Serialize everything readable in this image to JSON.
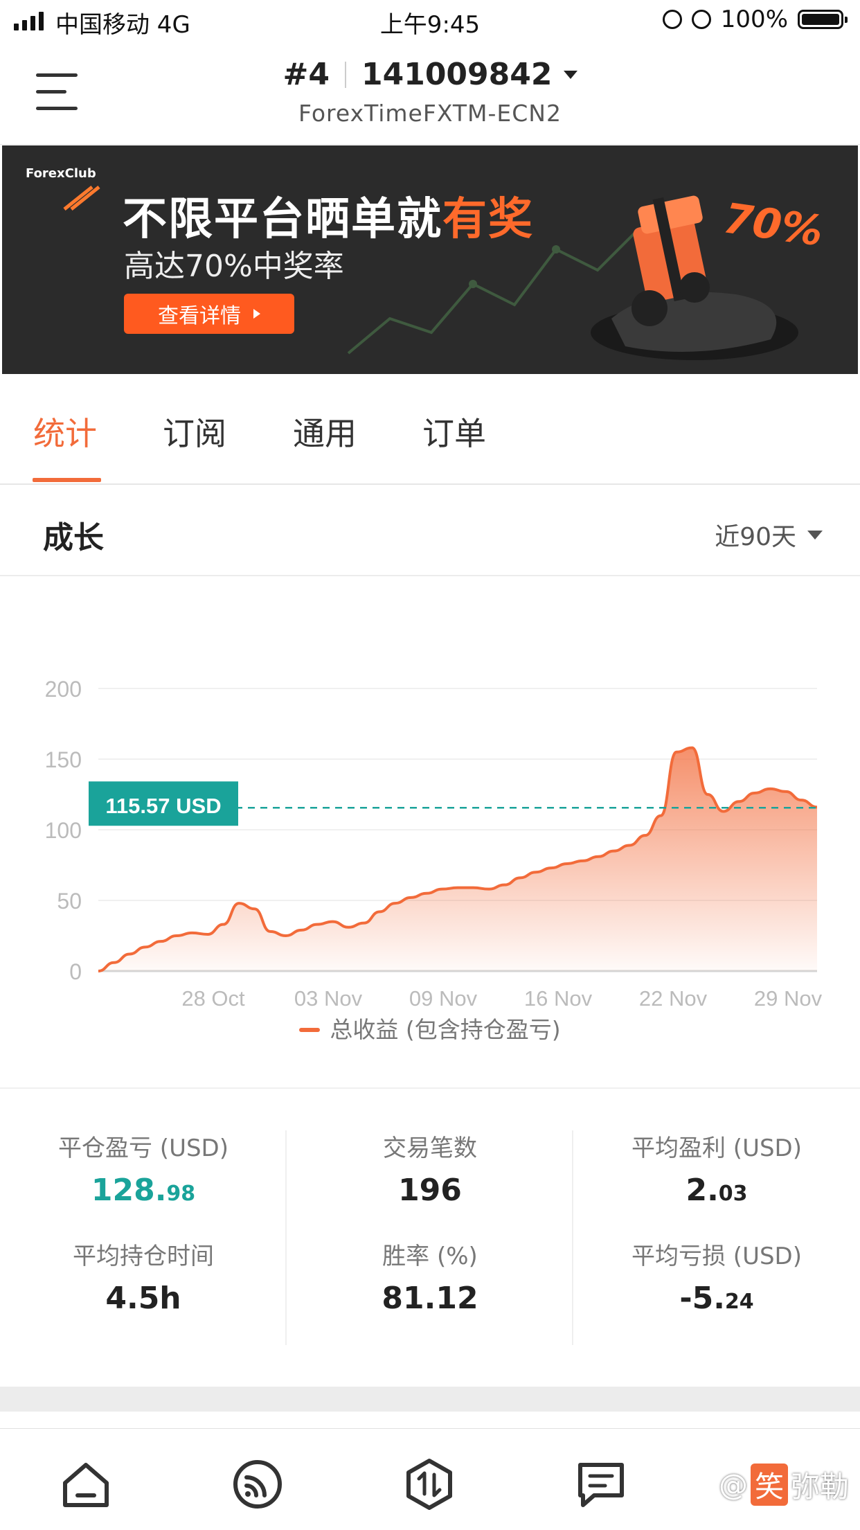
{
  "status_bar": {
    "carrier": "中国移动 4G",
    "time": "上午9:45",
    "battery": "100%",
    "icons": [
      "signal-icon",
      "alarm-icon",
      "rotation-lock-icon",
      "battery-icon"
    ]
  },
  "header": {
    "account_index": "#4",
    "account_number": "141009842",
    "server": "ForexTimeFXTM-ECN2",
    "menu_icon": "hamburger-menu-icon"
  },
  "banner": {
    "brand": "ForexClub",
    "title_main": "不限平台晒单就",
    "title_highlight": "有奖",
    "subtitle": "高达70%中奖率",
    "button_label": "查看详情",
    "percent_badge": "70%"
  },
  "tabs": [
    {
      "label": "统计",
      "active": true
    },
    {
      "label": "订阅",
      "active": false
    },
    {
      "label": "通用",
      "active": false
    },
    {
      "label": "订单",
      "active": false
    }
  ],
  "section": {
    "title": "成长",
    "range": "近90天"
  },
  "chart_data": {
    "type": "area",
    "ylim": [
      0,
      200
    ],
    "yticks": [
      0,
      50,
      100,
      150,
      200
    ],
    "x_tick_labels": [
      "28 Oct",
      "03 Nov",
      "09 Nov",
      "16 Nov",
      "22 Nov",
      "29 Nov"
    ],
    "current_value_label": "115.57 USD",
    "current_value": 115.57,
    "series": [
      {
        "name": "总收益 (包含持仓盈亏)",
        "color": "#f26b3a",
        "values": [
          0,
          6,
          12,
          17,
          21,
          25,
          27,
          26,
          33,
          48,
          44,
          28,
          25,
          29,
          33,
          35,
          31,
          34,
          42,
          48,
          52,
          55,
          58,
          59,
          59,
          58,
          61,
          66,
          70,
          73,
          76,
          78,
          81,
          85,
          89,
          96,
          110,
          155,
          158,
          125,
          113,
          120,
          126,
          129,
          127,
          121,
          116
        ]
      }
    ],
    "legend": "总收益 (包含持仓盈亏)"
  },
  "stats": [
    {
      "label": "平仓盈亏 (USD)",
      "int": "128.",
      "frac": "98",
      "color": "green"
    },
    {
      "label": "交易笔数",
      "int": "196",
      "frac": "",
      "color": "default"
    },
    {
      "label": "平均盈利 (USD)",
      "int": "2.",
      "frac": "03",
      "color": "default"
    },
    {
      "label": "平均持仓时间",
      "int": "4.5h",
      "frac": "",
      "color": "default"
    },
    {
      "label": "胜率 (%)",
      "int": "81.12",
      "frac": "",
      "color": "default"
    },
    {
      "label": "平均亏损 (USD)",
      "int": "-5.",
      "frac": "24",
      "color": "default"
    }
  ],
  "bottom_nav": [
    {
      "name": "home-icon"
    },
    {
      "name": "feed-icon"
    },
    {
      "name": "trade-icon"
    },
    {
      "name": "message-icon"
    }
  ],
  "watermark": {
    "prefix": "@",
    "boxed": "笑",
    "rest": "弥勒"
  }
}
